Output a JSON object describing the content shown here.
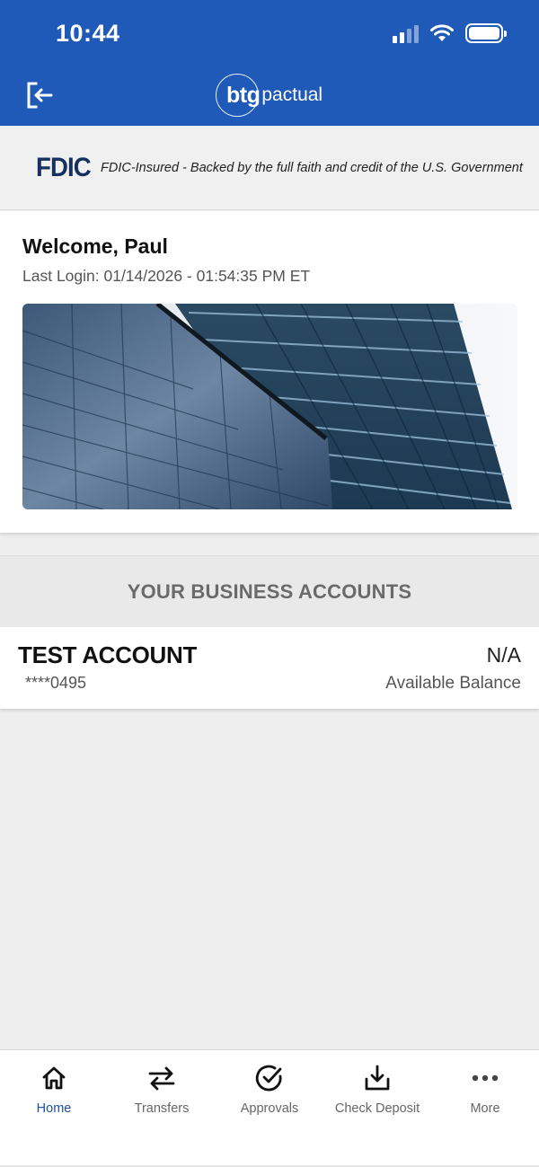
{
  "status_bar": {
    "time": "10:44"
  },
  "header": {
    "brand_btg": "btg",
    "brand_pactual": "pactual"
  },
  "fdic": {
    "logo_text": "FDIC",
    "tagline": "FDIC-Insured - Backed by the full faith and credit of the U.S. Government"
  },
  "welcome": {
    "title": "Welcome, Paul",
    "last_login": "Last Login: 01/14/2026 - 01:54:35 PM ET"
  },
  "accounts": {
    "section_title": "YOUR BUSINESS ACCOUNTS",
    "items": [
      {
        "name": "TEST ACCOUNT",
        "number": "****0495",
        "balance": "N/A",
        "balance_label": "Available Balance"
      }
    ]
  },
  "nav": {
    "items": [
      {
        "label": "Home",
        "icon": "home-icon",
        "active": true
      },
      {
        "label": "Transfers",
        "icon": "transfers-icon"
      },
      {
        "label": "Approvals",
        "icon": "approvals-icon"
      },
      {
        "label": "Check Deposit",
        "icon": "check-deposit-icon"
      },
      {
        "label": "More",
        "icon": "more-icon"
      }
    ]
  },
  "colors": {
    "header_bg": "#1f5ab8",
    "nav_active": "#1f4f9e",
    "page_bg": "#eeeeee"
  }
}
